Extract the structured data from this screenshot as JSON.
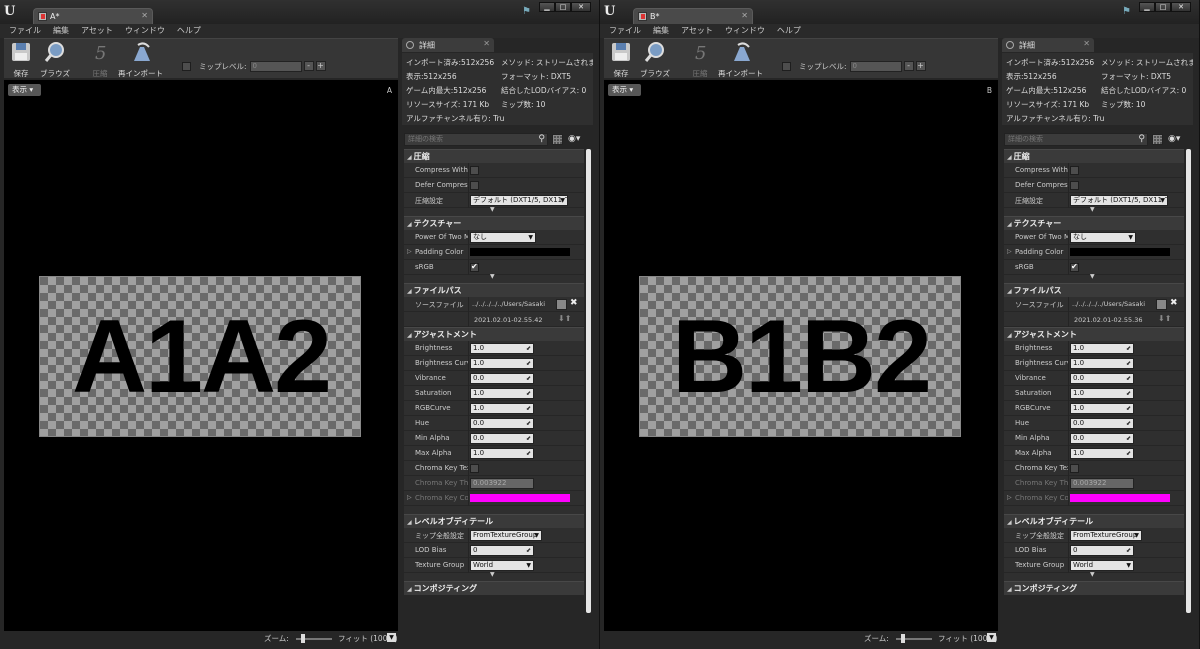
{
  "windows": [
    {
      "tab_title": "A*",
      "letter": "A",
      "texture_text": "A1A2",
      "info": {
        "imported": "インポート済み:512x256",
        "displayed": "表示:512x256",
        "max_ingame": "ゲーム内最大:512x256",
        "resource_size": "リソースサイズ: 171 Kb",
        "has_alpha": "アルファチャンネル有り: Tru",
        "method": "メソッド: ストリームされまし",
        "format": "フォーマット: DXT5",
        "combined_lod": "結合したLODバイアス: 0",
        "num_mips": "ミップ数: 10"
      },
      "source_path": "../../../../../Users/Sasaki",
      "timestamp": "2021.02.01-02.55.42"
    },
    {
      "tab_title": "B*",
      "letter": "B",
      "texture_text": "B1B2",
      "info": {
        "imported": "インポート済み:512x256",
        "displayed": "表示:512x256",
        "max_ingame": "ゲーム内最大:512x256",
        "resource_size": "リソースサイズ: 171 Kb",
        "has_alpha": "アルファチャンネル有り: Tru",
        "method": "メソッド: ストリームされまし",
        "format": "フォーマット: DXT5",
        "combined_lod": "結合したLODバイアス: 0",
        "num_mips": "ミップ数: 10"
      },
      "source_path": "../../../../../Users/Sasaki",
      "timestamp": "2021.02.01-02.55.36"
    }
  ],
  "menu": [
    "ファイル",
    "編集",
    "アセット",
    "ウィンドウ",
    "ヘルプ"
  ],
  "toolbar": {
    "save": "保存",
    "browse": "ブラウズ",
    "compress": "圧縮",
    "reimport": "再インポート",
    "mip_level_label": "ミップレベル:",
    "mip_level_value": "0"
  },
  "viewport": {
    "view_button": "表示",
    "zoom_label": "ズーム:",
    "zoom_value": "フィット (100%)"
  },
  "details": {
    "tab_label": "詳細",
    "search_placeholder": "詳細の検索",
    "categories": {
      "compression": "圧縮",
      "texture": "テクスチャー",
      "filepath": "ファイルパス",
      "adjustments": "アジャストメント",
      "lod": "レベルオブディテール",
      "compositing": "コンポジティング"
    },
    "compression": {
      "compress_without_alpha": "Compress Witho",
      "defer_compression": "Defer Compress",
      "compression_settings_label": "圧縮設定",
      "compression_settings_value": "デフォルト (DXT1/5, DX11 で"
    },
    "texture": {
      "power_of_two_label": "Power Of Two M",
      "power_of_two_value": "なし",
      "padding_color": "Padding Color",
      "srgb": "sRGB"
    },
    "filepath": {
      "source_file_label": "ソースファイル"
    },
    "adjustments": [
      {
        "label": "Brightness",
        "value": "1.0"
      },
      {
        "label": "Brightness Curve",
        "value": "1.0"
      },
      {
        "label": "Vibrance",
        "value": "0.0"
      },
      {
        "label": "Saturation",
        "value": "1.0"
      },
      {
        "label": "RGBCurve",
        "value": "1.0"
      },
      {
        "label": "Hue",
        "value": "0.0"
      },
      {
        "label": "Min Alpha",
        "value": "0.0"
      },
      {
        "label": "Max Alpha",
        "value": "1.0"
      }
    ],
    "chroma": {
      "chroma_key_texture": "Chroma Key Tex",
      "chroma_key_threshold_label": "Chroma Key Thr",
      "chroma_key_threshold_value": "0.003922",
      "chroma_key_color": "Chroma Key Col"
    },
    "lod": {
      "mip_gen_label": "ミップ全般設定",
      "mip_gen_value": "FromTextureGroup",
      "lod_bias_label": "LOD Bias",
      "lod_bias_value": "0",
      "texture_group_label": "Texture Group",
      "texture_group_value": "World"
    }
  },
  "colors": {
    "padding_color": "#000000",
    "chroma_key_color": "#ff00ff"
  }
}
